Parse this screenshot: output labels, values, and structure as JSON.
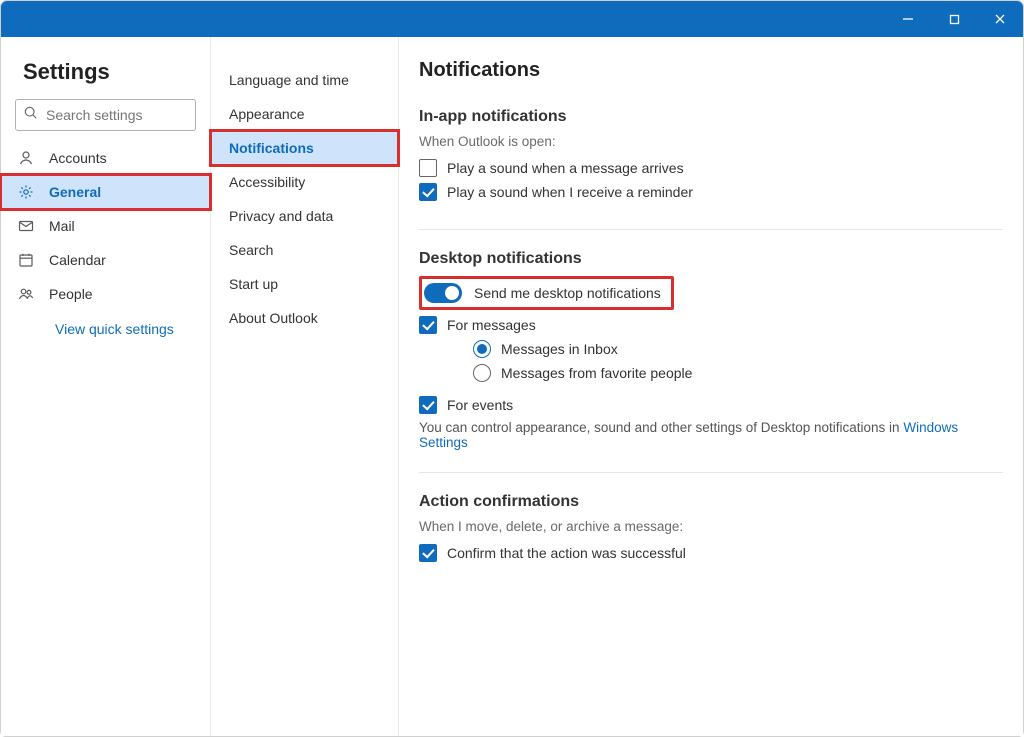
{
  "window_controls": {
    "minimize": "minimize",
    "maximize": "maximize",
    "close": "close"
  },
  "sidebar1": {
    "title": "Settings",
    "search_placeholder": "Search settings",
    "items": [
      {
        "icon": "person",
        "label": "Accounts"
      },
      {
        "icon": "gear",
        "label": "General",
        "selected": true,
        "highlight": true
      },
      {
        "icon": "mail",
        "label": "Mail"
      },
      {
        "icon": "calendar",
        "label": "Calendar"
      },
      {
        "icon": "people",
        "label": "People"
      }
    ],
    "quick_link": "View quick settings"
  },
  "sidebar2": {
    "items": [
      {
        "label": "Language and time"
      },
      {
        "label": "Appearance"
      },
      {
        "label": "Notifications",
        "selected": true,
        "highlight": true
      },
      {
        "label": "Accessibility"
      },
      {
        "label": "Privacy and data"
      },
      {
        "label": "Search"
      },
      {
        "label": "Start up"
      },
      {
        "label": "About Outlook"
      }
    ]
  },
  "main": {
    "title": "Notifications",
    "section_inapp": {
      "title": "In-app notifications",
      "subtitle": "When Outlook is open:",
      "opts": [
        {
          "label": "Play a sound when a message arrives",
          "checked": false
        },
        {
          "label": "Play a sound when I receive a reminder",
          "checked": true
        }
      ]
    },
    "section_desktop": {
      "title": "Desktop notifications",
      "toggle_label": "Send me desktop notifications",
      "toggle_on": true,
      "highlight_toggle": true,
      "for_messages": {
        "label": "For messages",
        "checked": true
      },
      "radio_options": [
        {
          "label": "Messages in Inbox",
          "checked": true
        },
        {
          "label": "Messages from favorite people",
          "checked": false
        }
      ],
      "for_events": {
        "label": "For events",
        "checked": true
      },
      "description_prefix": "You can control appearance, sound and other settings of Desktop notifications in ",
      "description_link": "Windows Settings"
    },
    "section_action": {
      "title": "Action confirmations",
      "subtitle": "When I move, delete, or archive a message:",
      "opt": {
        "label": "Confirm that the action was successful",
        "checked": true
      }
    }
  }
}
